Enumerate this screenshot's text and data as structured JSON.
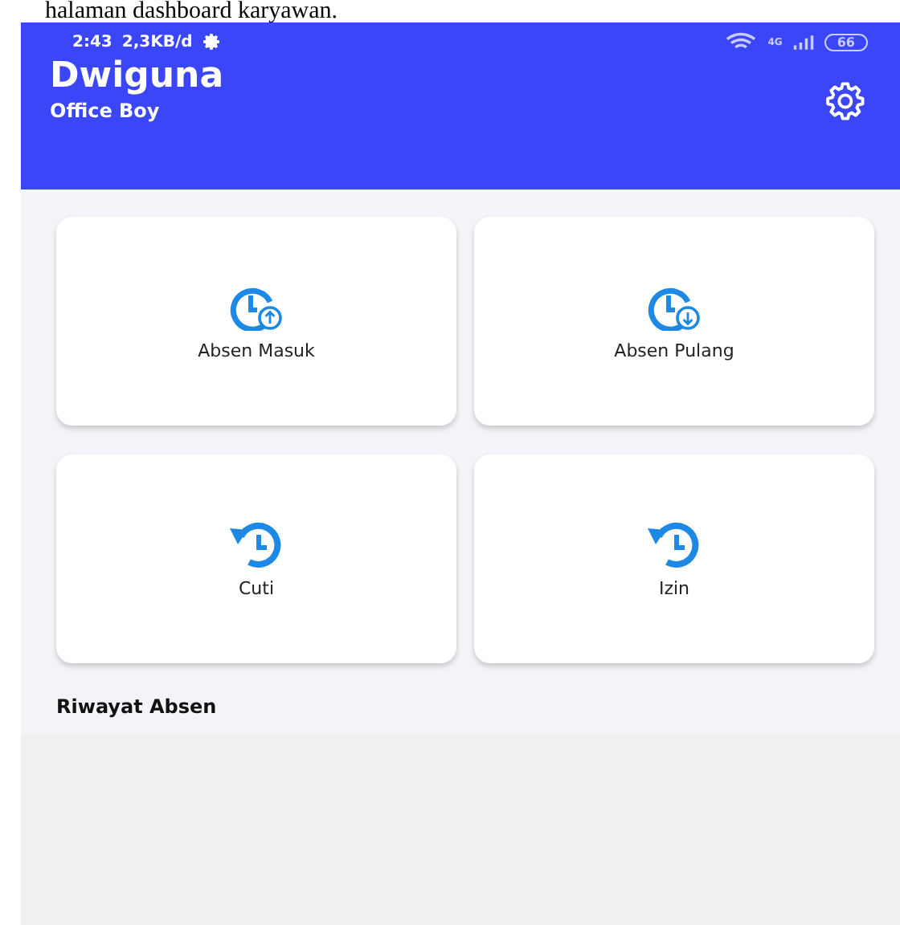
{
  "caption": "halaman dashboard karyawan.",
  "status_bar": {
    "time": "2:43",
    "speed": "2,3KB/d",
    "network": "4G",
    "battery": "66"
  },
  "header": {
    "name": "Dwiguna",
    "role": "Office Boy"
  },
  "menu": [
    {
      "label": "Absen Masuk",
      "kind": "clock-in"
    },
    {
      "label": "Absen Pulang",
      "kind": "clock-out"
    },
    {
      "label": "Cuti",
      "kind": "history"
    },
    {
      "label": "Izin",
      "kind": "history"
    }
  ],
  "history_title": "Riwayat Absen"
}
